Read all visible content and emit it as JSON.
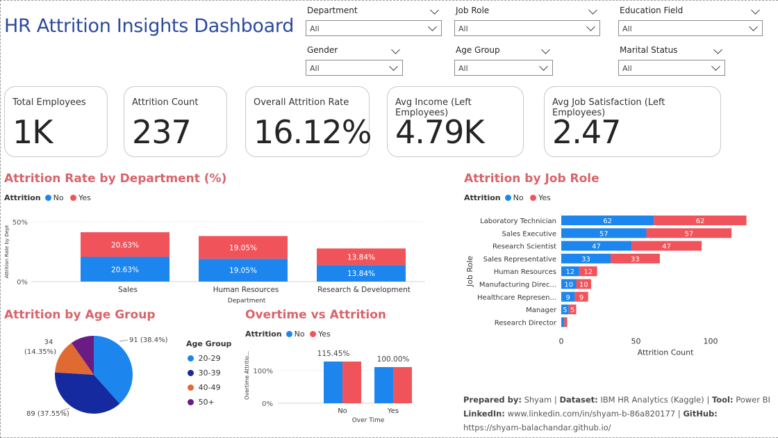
{
  "title": "HR Attrition Insights Dashboard",
  "slicers": [
    {
      "label": "Department",
      "value": "All"
    },
    {
      "label": "Job Role",
      "value": "All"
    },
    {
      "label": "Education Field",
      "value": "All"
    },
    {
      "label": "Gender",
      "value": "All"
    },
    {
      "label": "Age Group",
      "value": "All"
    },
    {
      "label": "Marital Status",
      "value": "All"
    }
  ],
  "kpis": [
    {
      "label": "Total Employees",
      "value": "1K"
    },
    {
      "label": "Attrition Count",
      "value": "237"
    },
    {
      "label": "Overall Attrition Rate",
      "value": "16.12%"
    },
    {
      "label": "Avg Income (Left Employees)",
      "value": "4.79K"
    },
    {
      "label": "Avg Job Satisfaction (Left Employees)",
      "value": "2.47"
    }
  ],
  "colors": {
    "no": "#1c86ee",
    "yes": "#f0545a",
    "title_red": "#d9646a",
    "dash_title": "#2b4a9c"
  },
  "legend": {
    "title": "Attrition",
    "no": "No",
    "yes": "Yes"
  },
  "dept_chart": {
    "title": "Attrition Rate by Department (%)",
    "chart_data": {
      "type": "bar",
      "stacked": true,
      "categories": [
        "Sales",
        "Human Resources",
        "Research & Development"
      ],
      "series": [
        {
          "name": "No",
          "values": [
            20.63,
            19.05,
            13.84
          ]
        },
        {
          "name": "Yes",
          "values": [
            20.63,
            19.05,
            13.84
          ]
        }
      ],
      "value_labels": [
        "20.63%",
        "19.05%",
        "13.84%"
      ],
      "xlabel": "Department",
      "ylabel": "Attrition Rate by Dept",
      "yticks": [
        "0%",
        "50%"
      ],
      "ylim": [
        0,
        50
      ]
    }
  },
  "role_chart": {
    "title": "Attrition by Job Role",
    "chart_data": {
      "type": "bar",
      "orientation": "horizontal",
      "stacked": true,
      "categories": [
        "Laboratory Technician",
        "Sales Executive",
        "Research Scientist",
        "Sales Representative",
        "Human Resources",
        "Manufacturing Direc...",
        "Healthcare Represen...",
        "Manager",
        "Research Director"
      ],
      "series": [
        {
          "name": "No",
          "values": [
            62,
            57,
            47,
            33,
            12,
            10,
            9,
            5,
            2
          ]
        },
        {
          "name": "Yes",
          "values": [
            62,
            57,
            47,
            33,
            12,
            10,
            9,
            5,
            2
          ]
        }
      ],
      "xlabel": "Attrition Count",
      "ylabel": "Job Role",
      "xticks": [
        0,
        50,
        100
      ],
      "xlim": [
        0,
        125
      ]
    }
  },
  "age_chart": {
    "title": "Attrition by Age Group",
    "legend_title": "Age Group",
    "chart_data": {
      "type": "pie",
      "labels": [
        "20-29",
        "30-39",
        "40-49",
        "50+"
      ],
      "values": [
        91,
        89,
        34,
        23
      ],
      "colors": [
        "#1c86ee",
        "#142a9e",
        "#e06b32",
        "#6b1b84"
      ],
      "data_labels": [
        "91 (38.4%)",
        "89 (37.55%)",
        "34\n(14.35%)",
        ""
      ]
    }
  },
  "overtime_chart": {
    "title": "Overtime vs Attrition",
    "chart_data": {
      "type": "bar",
      "stacked": false,
      "categories": [
        "No",
        "Yes"
      ],
      "series": [
        {
          "name": "No",
          "values": [
            115.45,
            100.0
          ]
        },
        {
          "name": "Yes",
          "values": [
            115.45,
            100.0
          ]
        }
      ],
      "value_labels": [
        "115.45%",
        "100.00%"
      ],
      "xlabel": "Over Time",
      "ylabel": "Overtime Attritio...",
      "yticks": [
        "0%",
        "100%"
      ],
      "ylim": [
        0,
        150
      ]
    }
  },
  "footer": {
    "prepared_by_label": "Prepared by:",
    "prepared_by": "Shyam",
    "dataset_label": "Dataset:",
    "dataset": "IBM HR Analytics (Kaggle)",
    "tool_label": "Tool:",
    "tool": "Power BI",
    "linkedin_label": "LinkedIn:",
    "linkedin": "www.linkedin.com/in/shyam-b-86a820177",
    "github_label": "GitHub:",
    "github": "https://shyam-balachandar.github.io/"
  }
}
